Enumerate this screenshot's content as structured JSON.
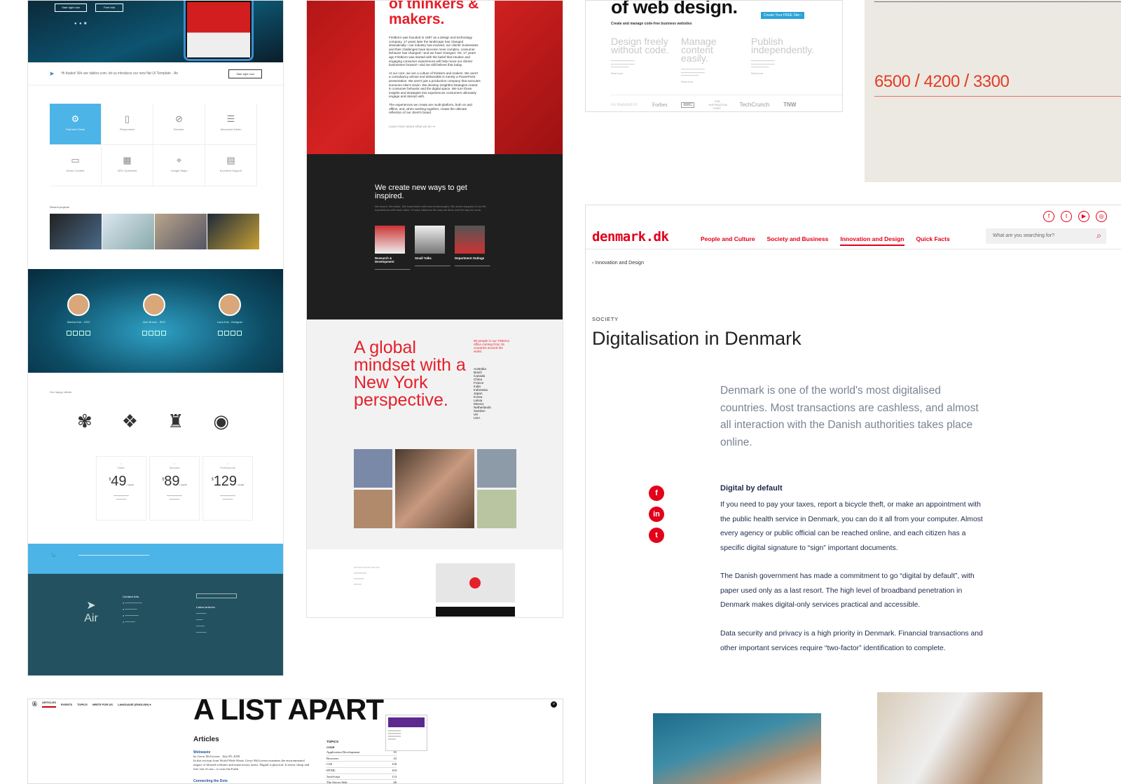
{
  "air": {
    "hero_btn1": "Start right now",
    "hero_btn2": "Free trial",
    "bar_text": "Hi dudes! We are tabloo.com, let us introduce our new flat UI Template - Air",
    "bar_cta": "Start right now",
    "features": [
      {
        "icon": "gears-icon",
        "label": "Fast and Clean"
      },
      {
        "icon": "devices-icon",
        "label": "Responsive"
      },
      {
        "icon": "compass-icon",
        "label": "Browser"
      },
      {
        "icon": "sliders-icon",
        "label": "Advanced Admin"
      },
      {
        "icon": "laptop-icon",
        "label": "Demo Content"
      },
      {
        "icon": "chart-icon",
        "label": "SEO Optimized"
      },
      {
        "icon": "map-pin-icon",
        "label": "Google Maps"
      },
      {
        "icon": "document-icon",
        "label": "Excellent Support"
      }
    ],
    "recent_projects": "Recent projects",
    "team": [
      "Marina Kok - CEO",
      "Alex Brown - SEO",
      "Lana Kok - Designer"
    ],
    "clients": "Our happy clients",
    "plans": [
      {
        "name": "Basic",
        "price": "49",
        "per": "/ month"
      },
      {
        "name": "Standart",
        "price": "89",
        "per": "/ month"
      },
      {
        "name": "Professional",
        "price": "129",
        "per": "/ month"
      }
    ],
    "currency": "$",
    "footer_logo": "Air",
    "contact_info": "Contact info",
    "latest_articles": "Latest articles"
  },
  "firstborn": {
    "headline": "of thinkers & makers.",
    "about": "Firstborn was founded in 1997 as a design and technology company. 17 years later the landscape has changed dramatically—our industry has evolved, our clients' businesses and their challenges have become more complex, consumer behavior has changed—and we have changed. Yet, 17 years ago Firstborn was started with the belief that intuitive and engaging consumer experiences will help move our clients' businesses forward—and we still believe that today.",
    "about2": "At our core, we are a culture of thinkers and makers. We aren't a consultancy whose end deliverable is merely a PowerPoint presentation. We aren't just a production company that executes someone else's vision. We develop insightful strategies rooted in consumer behavior and the digital space. We turn those insights and strategies into experiences consumers ultimately engage and interact with.",
    "about3": "The experiences we create are multi-platform, both on and offline, and, when working together, create the ultimate reflection of our client's brand.",
    "learn_more": "Learn more about what we do",
    "dark_title": "We create new ways to get inspired.",
    "dark_sub": "We invent. We tinker. We experiment with new technologies. We share snippets of our life experiences with each other. It helps influence the way we think and the way we work.",
    "tiles": [
      {
        "title": "Research & Development"
      },
      {
        "title": "Small Talks"
      },
      {
        "title": "Department Outings"
      }
    ],
    "global": "A global mindset with a New York perspective.",
    "people": "90 people in our TriBeCa office coming from 15 countries around the world.",
    "countries": [
      "Australia",
      "Brazil",
      "Canada",
      "China",
      "France",
      "India",
      "Indonesia",
      "Japan",
      "Korea",
      "Latvia",
      "Mexico",
      "Netherlands",
      "Sweden",
      "UK",
      "USA"
    ]
  },
  "webflow": {
    "headline": "of web design.",
    "cta": "Create Your FREE Site ›",
    "sub": "Create and manage code-free business websites",
    "cols": [
      {
        "title": "Design freely without code.",
        "more": "Read more"
      },
      {
        "title": "Manage content easily.",
        "more": "Read more"
      },
      {
        "title": "Publish independently.",
        "more": "Read more"
      }
    ],
    "featured": "As featured in:",
    "press": [
      "Forbes",
      "BBC",
      "THE HUFFINGTON POST",
      "TechCrunch",
      "TNW"
    ]
  },
  "poster": {
    "prices": [
      "6500",
      "4200",
      "3300"
    ]
  },
  "denmark": {
    "logo": "denmark.dk",
    "nav": [
      "People and Culture",
      "Society and Business",
      "Innovation and Design",
      "Quick Facts"
    ],
    "active_nav": "Innovation and Design",
    "search_placeholder": "What are you searching for?",
    "breadcrumb": "Innovation and Design",
    "category": "SOCIETY",
    "title": "Digitalisation in Denmark",
    "lead": "Denmark is one of the world's most digitalised countries. Most transactions are cashless, and almost all interaction with the Danish authorities takes place online.",
    "subhead": "Digital by default",
    "p1": "If you need to pay your taxes, report a bicycle theft, or make an appointment with the public health service in Denmark, you can do it all from your computer. Almost every agency or public official can be reached online, and each citizen has a specific digital signature to “sign” important documents.",
    "p2": "The Danish government has made a commitment to go “digital by default”, with paper used only as a last resort. The high level of broadband penetration in Denmark makes digital-only services practical and accessible.",
    "p3": "Data security and privacy is a high priority in Denmark. Financial transactions and other important services require “two-factor” identification to complete.",
    "accent": "#e2001a"
  },
  "ala": {
    "nav": [
      "ARTICLES",
      "EVENTS",
      "TOPICS",
      "WRITE FOR US",
      "LANGUAGE (ENGLISH) ▾"
    ],
    "masthead": "A LIST APART",
    "articles": "Articles",
    "item1_title": "Webwaste",
    "item1_meta": "by Gerry McGovern · July 09, 2020",
    "item1_text": "In this excerpt from World Wide Waste, Gerry McGovern examines the environmental impact of bloated websites and unnecessary assets. Digital is physical. It seems cheap and free, but it's not—it costs the Earth.",
    "item2_title": "Connecting the Dots",
    "topics_title": "TOPICS",
    "topics_sub": "CODE",
    "topics": [
      {
        "name": "Application Development",
        "n": "35"
      },
      {
        "name": "Browsers",
        "n": "43"
      },
      {
        "name": "CSS",
        "n": "158"
      },
      {
        "name": "HTML",
        "n": "104"
      },
      {
        "name": "JavaScript",
        "n": "114"
      },
      {
        "name": "The Server Side",
        "n": "46"
      }
    ]
  }
}
